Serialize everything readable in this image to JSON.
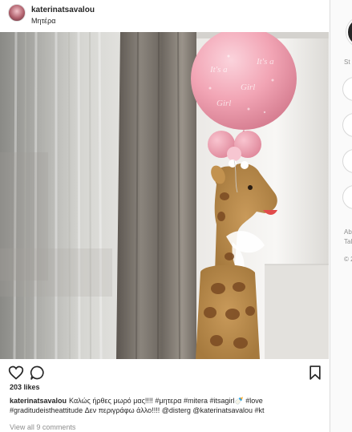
{
  "post": {
    "username": "katerinatsavalou",
    "location": "Μητέρα",
    "likes": "203 likes",
    "caption_user": "katerinatsavalou",
    "caption_text": "Καλώς ήρθες μωρό μας!!!! #μητερα #mitera #itsagirl🍼 #love #graditudeistheattitude Δεν περιγράφω άλλο!!!! @disterg @katerinatsavalou #kt",
    "view_comments": "View all 9 comments",
    "photo_description": "Pink balloon and plush giraffe by a window with sheer curtains"
  },
  "sidebar": {
    "section_label": "St",
    "footer_lines": [
      "Ab",
      "Tal",
      "© 2"
    ]
  },
  "icons": {
    "like": "heart-icon",
    "comment": "comment-icon",
    "save": "bookmark-icon",
    "profile": "profile-avatar-icon"
  },
  "colors": {
    "text": "#262626",
    "secondary": "#8e8e8e",
    "border": "#dbdbdb",
    "balloon": "#f0a3b3"
  }
}
